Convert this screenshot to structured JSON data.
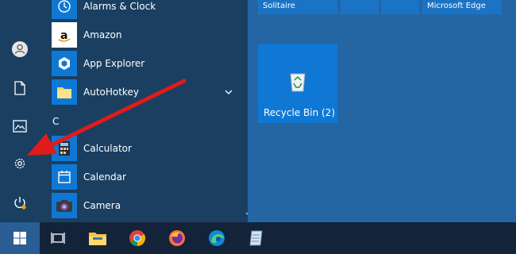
{
  "rail": {
    "items": [
      {
        "icon": "user-icon"
      },
      {
        "icon": "document-icon"
      },
      {
        "icon": "pictures-icon"
      },
      {
        "icon": "settings-gear-icon"
      },
      {
        "icon": "power-icon"
      }
    ]
  },
  "app_list": {
    "items": [
      {
        "label": "Alarms & Clock",
        "icon": "alarms-clock-icon"
      },
      {
        "label": "Amazon",
        "icon": "amazon-icon"
      },
      {
        "label": "App Explorer",
        "icon": "app-explorer-icon"
      },
      {
        "label": "AutoHotkey",
        "icon": "folder-icon"
      },
      {
        "label": "Calculator",
        "icon": "calculator-icon"
      },
      {
        "label": "Calendar",
        "icon": "calendar-icon"
      },
      {
        "label": "Camera",
        "icon": "camera-icon"
      }
    ],
    "group_letter": "C"
  },
  "tiles": {
    "top_left_label": "Solitaire",
    "top_right_label": "Microsoft Edge",
    "recycle_bin_label": "Recycle Bin (2)"
  },
  "taskbar": {
    "items": [
      {
        "icon": "windows-start-icon"
      },
      {
        "icon": "task-view-icon"
      },
      {
        "icon": "file-explorer-icon"
      },
      {
        "icon": "chrome-icon"
      },
      {
        "icon": "firefox-icon"
      },
      {
        "icon": "edge-icon"
      },
      {
        "icon": "notepad-icon"
      }
    ]
  },
  "colors": {
    "accent_tile": "#0f78d4",
    "arrow": "#e01b1b"
  }
}
